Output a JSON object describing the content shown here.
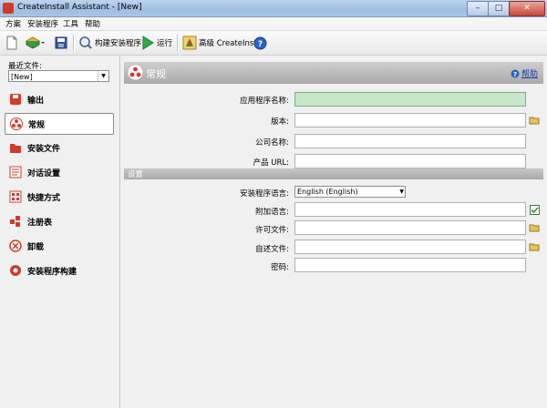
{
  "window": {
    "title": "CreateInstall Assistant - [New]",
    "close_label": "✕",
    "max_label": "□",
    "min_label": "–"
  },
  "menu": [
    "方案",
    "安装程序",
    "工具",
    "帮助"
  ],
  "toolbar": {
    "build_label": "构建安装程序",
    "run_label": "运行",
    "advanced_label": "高级 CreateInstall"
  },
  "sidebar": {
    "recent_label": "最近文件:",
    "recent_value": "[New]",
    "items": [
      "输出",
      "常规",
      "安装文件",
      "对话设置",
      "快捷方式",
      "注册表",
      "卸载",
      "安装程序构建"
    ]
  },
  "main": {
    "title": "常规",
    "help_label": "帮助",
    "fields": {
      "app_name_label": "应用程序名称:",
      "version_label": "版本:",
      "company_label": "公司名称:",
      "url_label": "产品 URL:"
    },
    "section_title": "设置",
    "settings": {
      "language_label": "安装程序语言:",
      "language_value": "English (English)",
      "extra_lang_label": "附加语言:",
      "license_label": "许可文件:",
      "readme_label": "自述文件:",
      "password_label": "密码:"
    }
  },
  "colors": {
    "accent_red": "#d23b2a",
    "focus_green": "#c8e6c8",
    "header_gray": "#a9a9a9"
  }
}
